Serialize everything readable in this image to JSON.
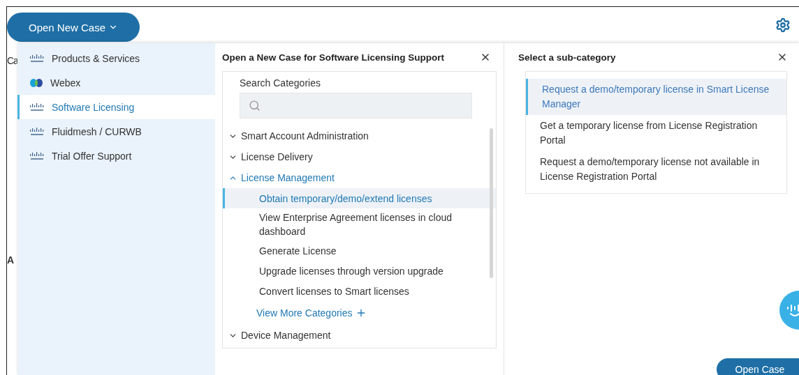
{
  "header": {
    "open_new_case": "Open New Case"
  },
  "background_texts": [
    "Ca",
    "A"
  ],
  "products": [
    {
      "label": "Products & Services",
      "kind": "cisco",
      "selected": false
    },
    {
      "label": "Webex",
      "kind": "webex",
      "selected": false
    },
    {
      "label": "Software Licensing",
      "kind": "cisco",
      "selected": true
    },
    {
      "label": "Fluidmesh / CURWB",
      "kind": "cisco",
      "selected": false
    },
    {
      "label": "Trial Offer Support",
      "kind": "cisco",
      "selected": false
    }
  ],
  "category_panel": {
    "title": "Open a New Case for Software Licensing Support",
    "search_label": "Search Categories",
    "categories": [
      {
        "label": "Smart Account Administration",
        "expanded": false
      },
      {
        "label": "License Delivery",
        "expanded": false
      },
      {
        "label": "License Management",
        "expanded": true,
        "children": [
          {
            "label": "Obtain temporary/demo/extend licenses",
            "selected": true
          },
          {
            "label": "View Enterprise Agreement licenses in cloud dashboard",
            "selected": false
          },
          {
            "label": "Generate License",
            "selected": false
          },
          {
            "label": "Upgrade licenses through version upgrade",
            "selected": false
          },
          {
            "label": "Convert licenses to Smart licenses",
            "selected": false
          }
        ],
        "more": "View More Categories"
      },
      {
        "label": "Device Management",
        "expanded": false
      }
    ]
  },
  "subcategory_panel": {
    "title": "Select a sub-category",
    "items": [
      {
        "label": "Request a demo/temporary license in Smart License Manager",
        "selected": true
      },
      {
        "label": "Get a temporary license from License Registration Portal",
        "selected": false
      },
      {
        "label": "Request a demo/temporary license not available in License Registration Portal",
        "selected": false
      }
    ]
  },
  "open_case_button": "Open Case"
}
